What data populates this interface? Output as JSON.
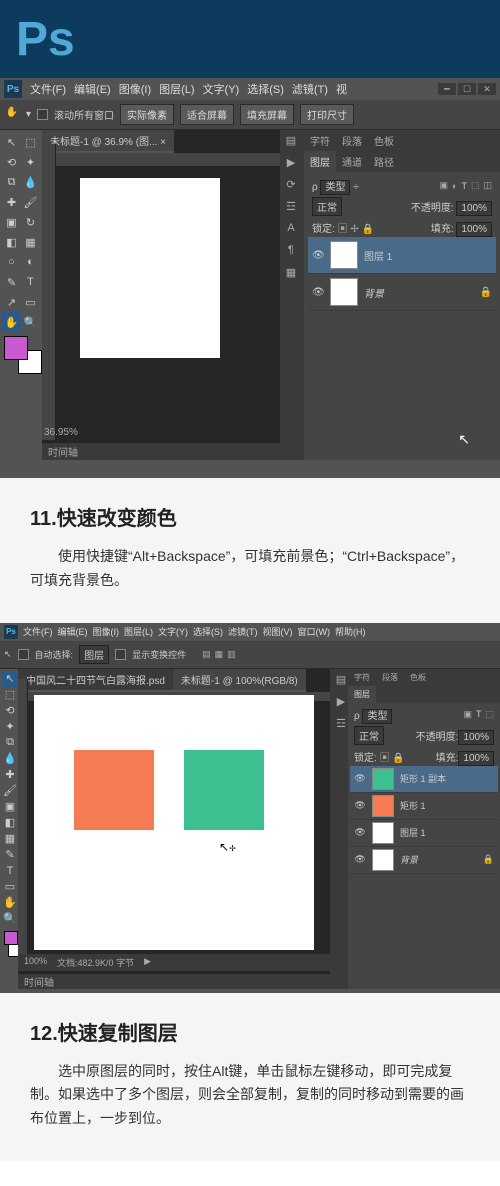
{
  "banner": {
    "logo": "Ps"
  },
  "app1": {
    "menus": [
      "文件(F)",
      "编辑(E)",
      "图像(I)",
      "图层(L)",
      "文字(Y)",
      "选择(S)",
      "滤镜(T)",
      "视"
    ],
    "options": {
      "scroll_all": "滚动所有窗口",
      "actual_pixels": "实际像素",
      "fit_screen": "适合屏幕",
      "fill_screen": "填充屏幕",
      "print_size": "打印尺寸"
    },
    "doc_tab": "未标题-1 @ 36.9% (图... ×",
    "zoom": "36.95%",
    "timeline": "时间轴",
    "panels": {
      "tabs_top": [
        "字符",
        "段落",
        "色板"
      ],
      "tabs_mid": [
        "图层",
        "通道",
        "路径"
      ],
      "type": "类型",
      "normal": "正常",
      "opacity_label": "不透明度:",
      "opacity_val": "100%",
      "lock_label": "锁定:",
      "fill_label": "填充:",
      "fill_val": "100%",
      "layers": [
        {
          "name": "图层 1",
          "selected": true
        },
        {
          "name": "背景",
          "locked": true
        }
      ]
    }
  },
  "section11": {
    "title": "11.快速改变颜色",
    "text": "使用快捷键“Alt+Backspace”，可填充前景色；“Ctrl+Backspace”，可填充背景色。"
  },
  "app2": {
    "menus": [
      "文件(F)",
      "编辑(E)",
      "图像(I)",
      "图层(L)",
      "文字(Y)",
      "选择(S)",
      "滤镜(T)",
      "视图(V)",
      "窗口(W)",
      "帮助(H)"
    ],
    "options": {
      "auto_select": "自动选择:",
      "layer": "图层",
      "show_transform": "显示变换控件"
    },
    "doc_tabs": [
      "中国风二十四节气白露海报.psd",
      "未标题-1 @ 100%(RGB/8)"
    ],
    "zoom": "100%",
    "doc_info": "文档:482.9K/0 字节",
    "timeline": "时间轴",
    "panels": {
      "tabs_top": [
        "字符",
        "段落",
        "色板"
      ],
      "tabs_mid": [
        "图层"
      ],
      "type": "类型",
      "normal": "正常",
      "opacity_label": "不透明度:",
      "opacity_val": "100%",
      "lock_label": "锁定:",
      "fill_label": "填充:",
      "fill_val": "100%",
      "layers": [
        {
          "name": "矩形 1 副本",
          "color": "#3cc08f",
          "selected": true
        },
        {
          "name": "矩形 1",
          "color": "#f47b52"
        },
        {
          "name": "图层 1"
        },
        {
          "name": "背景",
          "locked": true
        }
      ]
    }
  },
  "section12": {
    "title": "12.快速复制图层",
    "text": "选中原图层的同时，按住Alt键，单击鼠标左键移动，即可完成复制。如果选中了多个图层，则会全部复制，复制的同时移动到需要的画布位置上，一步到位。"
  }
}
